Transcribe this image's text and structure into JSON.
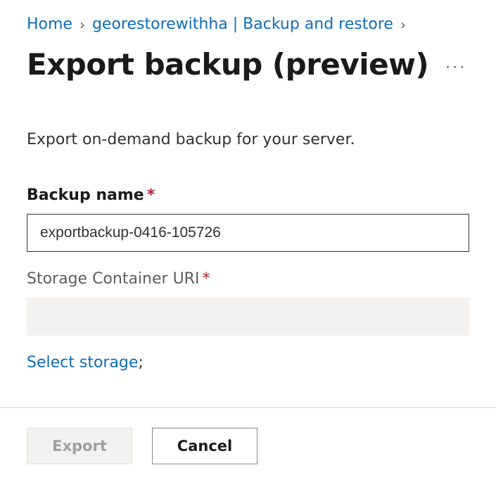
{
  "breadcrumb": {
    "home": "Home",
    "resource": "georestorewithha | Backup and restore"
  },
  "page": {
    "title": "Export backup (preview)",
    "description": "Export on-demand backup for your server."
  },
  "fields": {
    "backup_name": {
      "label": "Backup name",
      "value": "exportbackup-0416-105726"
    },
    "storage_uri": {
      "label": "Storage Container URI",
      "value": ""
    }
  },
  "links": {
    "select_storage": "Select storage",
    "select_storage_suffix": ";"
  },
  "actions": {
    "export": "Export",
    "cancel": "Cancel"
  }
}
